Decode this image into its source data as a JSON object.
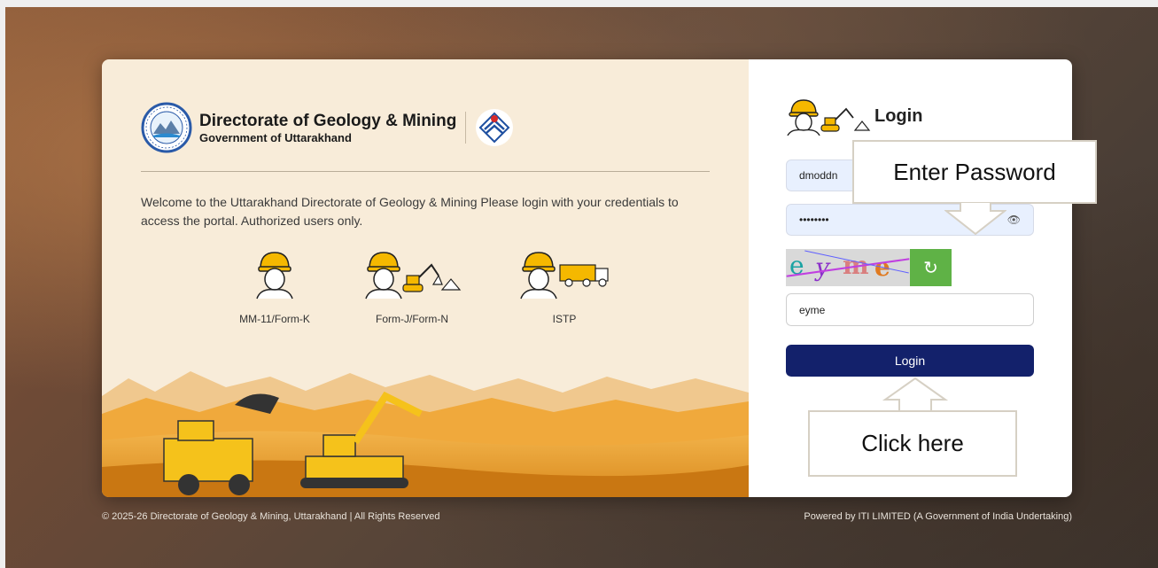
{
  "brand": {
    "title": "Directorate of Geology & Mining",
    "subtitle": "Government of Uttarakhand"
  },
  "welcome_text": "Welcome to the Uttarakhand Directorate of Geology & Mining Please login with your credentials to access the portal. Authorized users only.",
  "roles": [
    {
      "label": "MM-11/Form-K"
    },
    {
      "label": "Form-J/Form-N"
    },
    {
      "label": "ISTP"
    }
  ],
  "login": {
    "title": "Login",
    "username_value": "dmoddn",
    "password_value": "••••••••",
    "captcha_value": "eyme",
    "button_label": "Login"
  },
  "captcha_text": [
    "e",
    "y",
    "m",
    "e"
  ],
  "callouts": {
    "password": "Enter Password",
    "click": "Click here"
  },
  "footer": {
    "left": "© 2025-26 Directorate of Geology & Mining, Uttarakhand | All Rights Reserved",
    "right": "Powered by ITI LIMITED (A Government of India Undertaking)"
  },
  "colors": {
    "primary_button": "#13216b",
    "refresh_button": "#5fb246",
    "left_panel": "#f8ecd9",
    "field_bg": "#e8f0fe"
  },
  "icons": {
    "emblem": "dgm-emblem-icon",
    "state_logo": "uttarakhand-logo-icon",
    "worker": "miner-helmet-icon",
    "excavator": "excavator-icon",
    "truck": "truck-icon",
    "eye": "eye-slash-icon",
    "refresh": "refresh-icon"
  }
}
